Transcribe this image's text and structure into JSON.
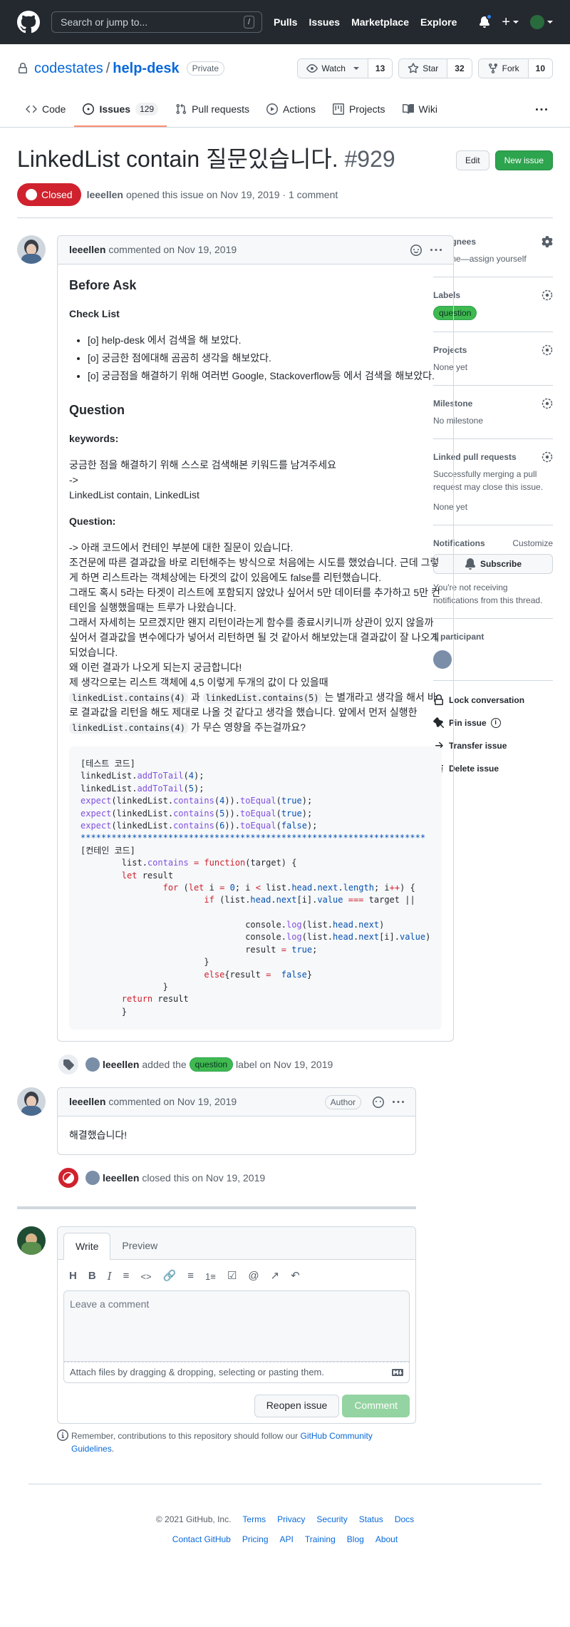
{
  "header": {
    "search_placeholder": "Search or jump to...",
    "slash": "/",
    "nav": [
      "Pulls",
      "Issues",
      "Marketplace",
      "Explore"
    ]
  },
  "repo": {
    "owner": "codestates",
    "sep": "/",
    "name": "help-desk",
    "visibility": "Private",
    "watch_label": "Watch",
    "watch_count": "13",
    "star_label": "Star",
    "star_count": "32",
    "fork_label": "Fork",
    "fork_count": "10"
  },
  "tabs": [
    {
      "label": "Code"
    },
    {
      "label": "Issues",
      "count": "129"
    },
    {
      "label": "Pull requests"
    },
    {
      "label": "Actions"
    },
    {
      "label": "Projects"
    },
    {
      "label": "Wiki"
    }
  ],
  "issue": {
    "title": "LinkedList contain 질문있습니다.",
    "number": "#929",
    "edit_label": "Edit",
    "new_issue_label": "New issue",
    "state": "Closed",
    "author": "leeellen",
    "opened_text": "opened this issue on Nov 19, 2019 · 1 comment"
  },
  "comment1": {
    "author": "leeellen",
    "date_text": "commented on Nov 19, 2019",
    "h_before": "Before Ask",
    "h_checklist": "Check List",
    "checklist": [
      "[o] help-desk 에서 검색을 해 보았다.",
      "[o] 궁금한 점에대해 곰곰히 생각을 해보았다.",
      "[o] 궁금점을 해결하기 위해 여러번 Google, Stackoverflow등 에서 검색을 해보았다."
    ],
    "h_question": "Question",
    "h_keywords": "keywords:",
    "keywords_1": "궁금한 점을 해결하기 위해 스스로 검색해본 키워드를 남겨주세요",
    "keywords_2": "->",
    "keywords_3": "LinkedList contain, LinkedList",
    "h_question2": "Question:",
    "question_lines": [
      "-> 아래 코드에서 컨테인 부분에 대한 질문이 있습니다.",
      "조건문에 따른 결과값을 바로 리턴해주는 방식으로 처음에는 시도를 했었습니다. 근데 그렇게 하면 리스트라는 객체상에는 타겟의 값이 있음에도 false를 리턴했습니다.",
      "그래도 혹시 5라는 타겟이 리스트에 포함되지 않았나 싶어서 5만 데이터를 추가하고 5만 컨테인을 실행했을때는 트루가 나왔습니다.",
      "그래서 자세히는 모르겠지만 왠지 리턴이라는게 함수를 종료시키니까 상관이 있지 않을까 싶어서 결과값을 변수에다가 넣어서 리턴하면 될 것 같아서 해보았는대 결과값이 잘 나오게 되었습니다.",
      "왜 이런 결과가 나오게 되는지 궁금합니다!",
      "제 생각으로는 리스트 객체에 4,5 이렇게 두개의 값이 다 있을때"
    ],
    "q_code1": "linkedList.contains(4)",
    "q_and": " 과 ",
    "q_code2": "linkedList.contains(5)",
    "q_mid": " 는 별개라고 생각을 해서 바로 결과값을 리턴을 해도 제대로 나올 것 같다고 생각을 했습니다. 앞에서 먼저 실행한 ",
    "q_code3": "linkedList.contains(4)",
    "q_end": " 가 무슨 영향을 주는걸까요?"
  },
  "label_event": {
    "author": "leeellen",
    "pre": "added the",
    "label": "question",
    "post": "label on Nov 19, 2019"
  },
  "comment2": {
    "author": "leeellen",
    "date_text": "commented on Nov 19, 2019",
    "badge": "Author",
    "body": "해결했습니다!"
  },
  "close_event": {
    "author": "leeellen",
    "text": "closed this on Nov 19, 2019"
  },
  "form": {
    "write_tab": "Write",
    "preview_tab": "Preview",
    "placeholder": "Leave a comment",
    "attach_text": "Attach files by dragging & dropping, selecting or pasting them.",
    "reopen_label": "Reopen issue",
    "comment_label": "Comment",
    "remember_pre": "Remember, contributions to this repository should follow our",
    "remember_link": "GitHub Community Guidelines",
    "remember_post": "."
  },
  "sidebar": {
    "assignees_title": "Assignees",
    "assignees_text": "No one—assign yourself",
    "labels_title": "Labels",
    "label": "question",
    "projects_title": "Projects",
    "projects_text": "None yet",
    "milestone_title": "Milestone",
    "milestone_text": "No milestone",
    "linked_title": "Linked pull requests",
    "linked_text": "Successfully merging a pull request may close this issue.",
    "linked_none": "None yet",
    "notif_title": "Notifications",
    "customize": "Customize",
    "subscribe": "Subscribe",
    "notif_text": "You're not receiving notifications from this thread.",
    "participants": "1 participant",
    "lock": "Lock conversation",
    "pin": "Pin issue",
    "transfer": "Transfer issue",
    "delete": "Delete issue"
  },
  "footer": {
    "copyright": "© 2021 GitHub, Inc.",
    "row1": [
      "Terms",
      "Privacy",
      "Security",
      "Status",
      "Docs"
    ],
    "row2": [
      "Contact GitHub",
      "Pricing",
      "API",
      "Training",
      "Blog",
      "About"
    ]
  },
  "colors": {
    "header_bg": "#24292f",
    "closed_red": "#cf222e",
    "green": "#2da44e",
    "link_blue": "#0969da"
  }
}
